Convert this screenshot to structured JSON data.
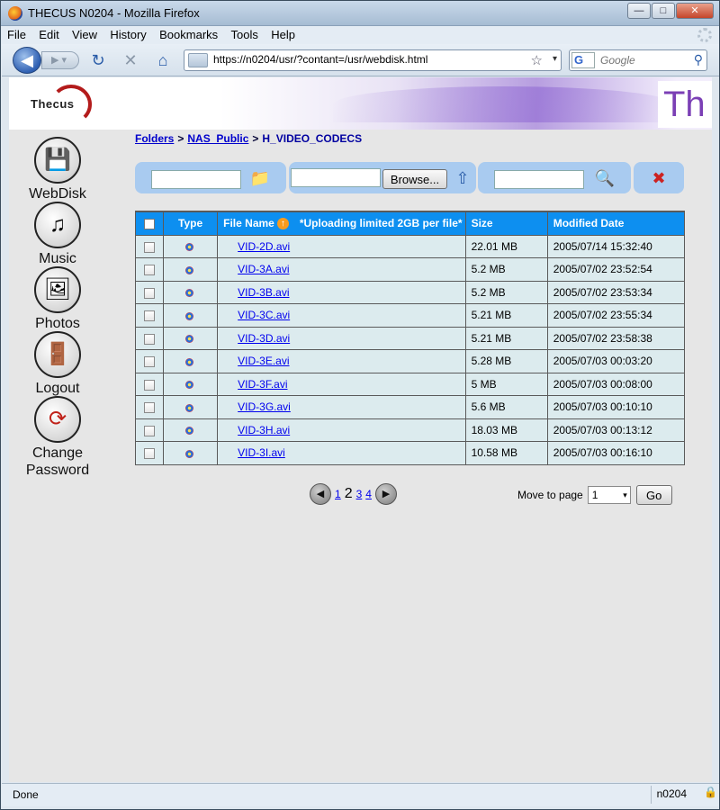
{
  "window": {
    "title": "THECUS N0204 - Mozilla Firefox",
    "controls": {
      "minimize": "—",
      "maximize": "□",
      "close": "✕"
    }
  },
  "menu": [
    "File",
    "Edit",
    "View",
    "History",
    "Bookmarks",
    "Tools",
    "Help"
  ],
  "nav": {
    "url": "https://n0204/usr/?contant=/usr/webdisk.html",
    "search_placeholder": "Google",
    "search_engine_letter": "G",
    "back_glyph": "◀",
    "forward_glyph": "▶ ▾",
    "reload_glyph": "↻",
    "stop_glyph": "✕",
    "home_glyph": "⌂",
    "star_glyph": "☆",
    "dropdown_glyph": "▾",
    "search_glyph": "⚲"
  },
  "banner": {
    "logo_text": "Thecus",
    "brand_partial": "Th"
  },
  "sidebar": {
    "items": [
      {
        "label": "WebDisk",
        "glyph": "💾"
      },
      {
        "label": "Music",
        "glyph": "♫"
      },
      {
        "label": "Photos",
        "glyph": "🖼"
      },
      {
        "label": "Logout",
        "glyph": "🚪"
      },
      {
        "label": "Change Password",
        "glyph": "⟳"
      }
    ]
  },
  "breadcrumb": {
    "root": "Folders",
    "sep": ">",
    "level1": "NAS_Public",
    "current": "H_VIDEO_CODECS"
  },
  "toolbar": {
    "browse_label": "Browse...",
    "new_folder_glyph": "📁",
    "upload_glyph": "⇧",
    "search_glyph": "🔍",
    "delete_glyph": "✖"
  },
  "table": {
    "headers": {
      "type": "Type",
      "filename": "File Name",
      "upload_note": "*Uploading limited 2GB per file*",
      "size": "Size",
      "modified": "Modified Date"
    },
    "sort_glyph": "↑",
    "rows": [
      {
        "name": "VID-2D.avi",
        "size": "22.01 MB",
        "date": "2005/07/14 15:32:40"
      },
      {
        "name": "VID-3A.avi",
        "size": "5.2 MB",
        "date": "2005/07/02 23:52:54"
      },
      {
        "name": "VID-3B.avi",
        "size": "5.2 MB",
        "date": "2005/07/02 23:53:34"
      },
      {
        "name": "VID-3C.avi",
        "size": "5.21 MB",
        "date": "2005/07/02 23:55:34"
      },
      {
        "name": "VID-3D.avi",
        "size": "5.21 MB",
        "date": "2005/07/02 23:58:38"
      },
      {
        "name": "VID-3E.avi",
        "size": "5.28 MB",
        "date": "2005/07/03 00:03:20"
      },
      {
        "name": "VID-3F.avi",
        "size": "5 MB",
        "date": "2005/07/03 00:08:00"
      },
      {
        "name": "VID-3G.avi",
        "size": "5.6 MB",
        "date": "2005/07/03 00:10:10"
      },
      {
        "name": "VID-3H.avi",
        "size": "18.03 MB",
        "date": "2005/07/03 00:13:12"
      },
      {
        "name": "VID-3I.avi",
        "size": "10.58 MB",
        "date": "2005/07/03 00:16:10"
      }
    ]
  },
  "pager": {
    "prev_glyph": "◀",
    "next_glyph": "▶",
    "page1": "1",
    "current": "2",
    "page3": "3",
    "page4": "4",
    "moveto_label": "Move to page",
    "moveto_value": "1",
    "select_arrow": "▾",
    "go_label": "Go"
  },
  "status": {
    "text": "Done",
    "host": "n0204",
    "lock_glyph": "🔒"
  },
  "colors": {
    "table_header": "#0d8ff0",
    "row_bg": "#dcebee",
    "toolbar_bg": "#a9cbf0",
    "link": "#0000ee"
  }
}
